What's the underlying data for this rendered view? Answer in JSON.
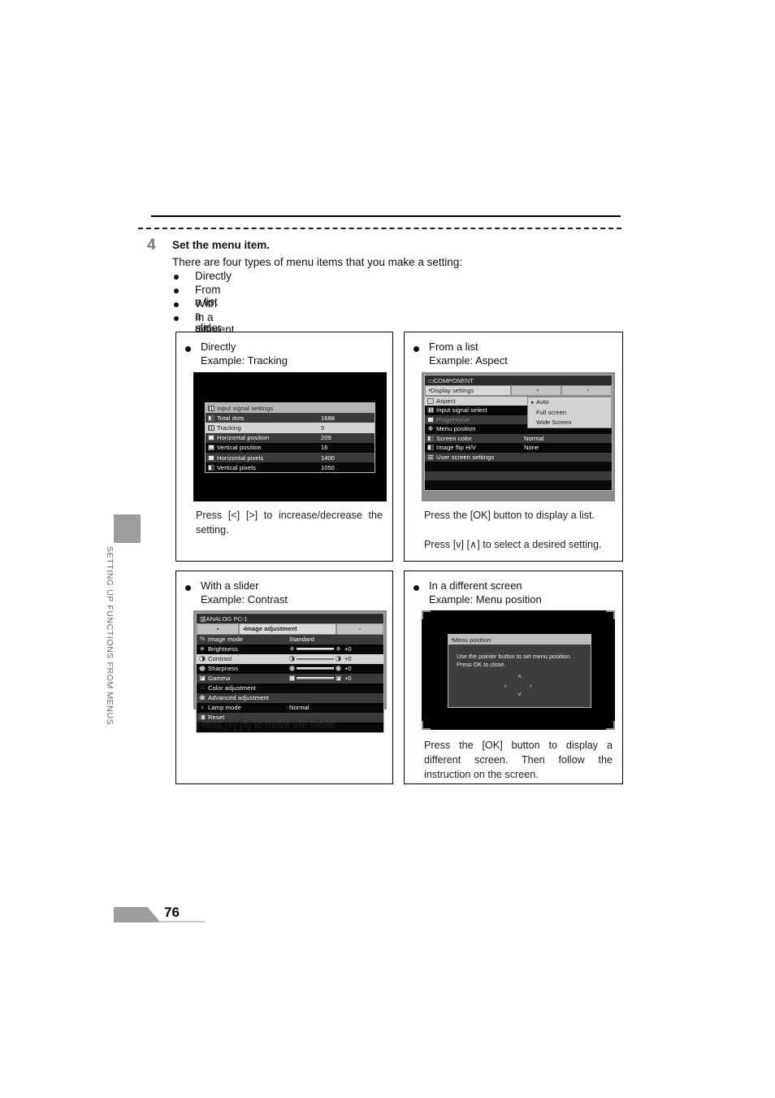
{
  "document": {
    "page_number": "76",
    "side_tab_label": "SETTING UP FUNCTIONS FROM MENUS"
  },
  "step": {
    "number": "4",
    "title": "Set the menu item.",
    "subtitle": "There are four types of menu items that you make a setting:",
    "bullets": [
      {
        "label": "Directly"
      },
      {
        "label": "From a list"
      },
      {
        "label": "With a slider"
      },
      {
        "label": "In a different screen"
      }
    ]
  },
  "panels": [
    {
      "id": "directly",
      "title": "Directly",
      "example": "Example: Tracking",
      "caption": "Press [<] [>] to increase/decrease the setting.",
      "osd": {
        "menu_title": "Input signal settings",
        "rows": [
          {
            "label": "Total dots",
            "value": "1688",
            "icon": "dotted-grid-icon",
            "state": "normal"
          },
          {
            "label": "Tracking",
            "value": "5",
            "icon": "tracking-icon",
            "state": "selected"
          },
          {
            "label": "Horizontal position",
            "value": "209",
            "icon": "h-position-icon",
            "state": "mid"
          },
          {
            "label": "Vertical position",
            "value": "16",
            "icon": "v-position-icon",
            "state": "dark"
          },
          {
            "label": "Horizontal pixels",
            "value": "1400",
            "icon": "h-pixels-icon",
            "state": "mid"
          },
          {
            "label": "Vertical pixels",
            "value": "1050",
            "icon": "v-pixels-icon",
            "state": "dark"
          }
        ]
      }
    },
    {
      "id": "from-a-list",
      "title": "From a list",
      "example": "Example: Aspect",
      "caption_line1": "Press the [OK] button to display a list.",
      "caption_line2": "Press [v] [∧] to select a desired setting.",
      "osd": {
        "source_label": "COMPONENT",
        "tabs": [
          {
            "label": "Display settings",
            "icon": "display-icon",
            "active": true
          },
          {
            "label": "",
            "icon": "image-adjust-icon",
            "active": false
          },
          {
            "label": "",
            "icon": "install-icon",
            "active": false
          }
        ],
        "rows": [
          {
            "label": "Aspect",
            "value": "",
            "icon": "aspect-icon",
            "state": "selected"
          },
          {
            "label": "Input signal select",
            "value": "",
            "icon": "input-select-icon",
            "state": "dark"
          },
          {
            "label": "Progressive",
            "value": "",
            "icon": "progressive-icon",
            "state": "mid",
            "dim": true
          },
          {
            "label": "Menu position",
            "value": "",
            "icon": "menu-position-icon",
            "state": "dark"
          },
          {
            "label": "Screen color",
            "value": "Normal",
            "icon": "screen-color-icon",
            "state": "mid"
          },
          {
            "label": "Image flip H/V",
            "value": "None",
            "icon": "image-flip-icon",
            "state": "dark"
          },
          {
            "label": "User screen settings",
            "value": "",
            "icon": "user-screen-icon",
            "state": "mid"
          },
          {
            "label": "",
            "value": "",
            "icon": "",
            "state": "dark"
          },
          {
            "label": "",
            "value": "",
            "icon": "",
            "state": "mid"
          },
          {
            "label": "",
            "value": "",
            "icon": "",
            "state": "dark"
          }
        ],
        "dropdown": {
          "options": [
            {
              "label": "Auto",
              "selected": true
            },
            {
              "label": "Full screen",
              "selected": false
            },
            {
              "label": "Wide Screen",
              "selected": false
            }
          ]
        }
      }
    },
    {
      "id": "with-a-slider",
      "title": "With a slider",
      "example": "Example: Contrast",
      "caption": "Press [<] [>] to move the slider.",
      "osd": {
        "source_label": "ANALOG PC-1",
        "tabs": [
          {
            "label": "",
            "icon": "display-icon",
            "active": false
          },
          {
            "label": "Image adjustment",
            "icon": "image-adjust-icon",
            "active": true
          },
          {
            "label": "",
            "icon": "install-icon",
            "active": false
          }
        ],
        "rows": [
          {
            "label": "Image mode",
            "value": "Standard",
            "type": "value",
            "icon": "image-mode-icon",
            "state": "mid"
          },
          {
            "label": "Brightness",
            "value": "+0",
            "type": "slider",
            "icon": "brightness-icon",
            "state": "dark",
            "fill": 72
          },
          {
            "label": "Contrast",
            "value": "+0",
            "type": "slider",
            "icon": "contrast-icon",
            "state": "selected",
            "fill": 55
          },
          {
            "label": "Sharpness",
            "value": "+0",
            "type": "slider",
            "icon": "sharpness-icon",
            "state": "dark",
            "fill": 88
          },
          {
            "label": "Gamma",
            "value": "+0",
            "type": "slider",
            "icon": "gamma-icon",
            "state": "mid",
            "fill": 78
          },
          {
            "label": "Color adjustment",
            "value": "",
            "type": "plain",
            "icon": "color-adjust-icon",
            "state": "dark"
          },
          {
            "label": "Advanced adjustment",
            "value": "",
            "type": "plain",
            "icon": "advanced-icon",
            "state": "mid"
          },
          {
            "label": "Lamp mode",
            "value": "Normal",
            "type": "value",
            "icon": "lamp-icon",
            "state": "dark"
          },
          {
            "label": "Reset",
            "value": "",
            "type": "plain",
            "icon": "reset-icon",
            "state": "mid"
          },
          {
            "label": "",
            "value": "",
            "type": "plain",
            "icon": "",
            "state": "dark"
          }
        ]
      }
    },
    {
      "id": "in-a-different-screen",
      "title": "In a different screen",
      "example": "Example: Menu position",
      "caption": "Press the [OK] button to display a different screen. Then follow the instruction on the screen.",
      "dialog": {
        "title": "Menu position",
        "line1": "Use the pointer button to set menu position.",
        "line2": "Press OK to close.",
        "dpad": {
          "up": "˄",
          "down": "˅",
          "left": "‹",
          "right": "›"
        }
      }
    }
  ],
  "colors": {
    "osd_title_bar": "#b5b5b5",
    "osd_row_dark": "#080808",
    "osd_row_mid": "#3a3a3a",
    "osd_row_selected": "#d4d4d4",
    "side_tab": "#9d9d9d",
    "page_text": "#1a1a1a"
  }
}
